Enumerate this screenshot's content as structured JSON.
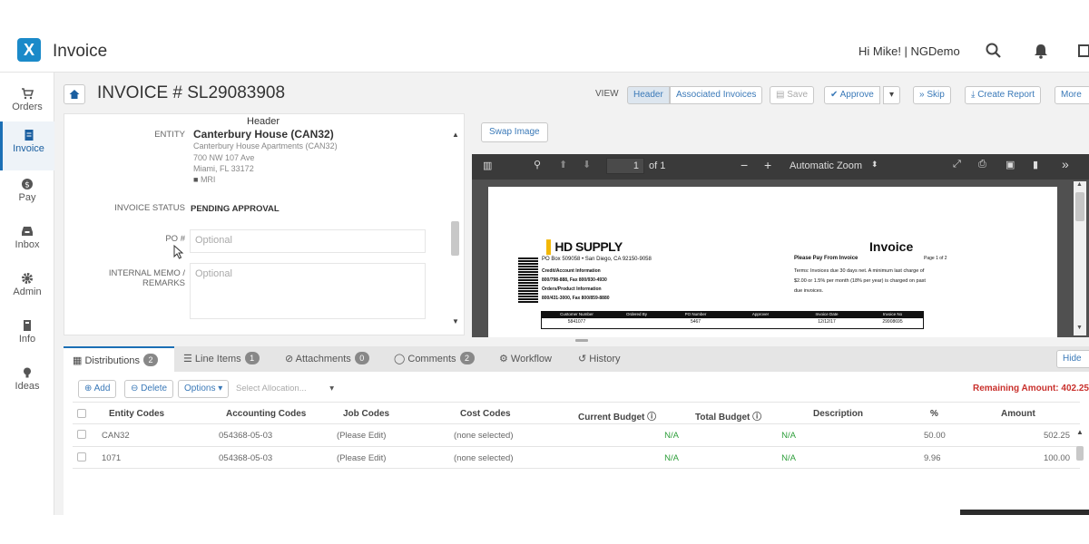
{
  "app": {
    "logo_letter": "X",
    "title": "Invoice",
    "greeting": "Hi Mike! | NGDemo"
  },
  "sidebar": {
    "items": [
      {
        "label": "Orders",
        "icon": "cart-icon"
      },
      {
        "label": "Invoice",
        "icon": "invoice-icon"
      },
      {
        "label": "Pay",
        "icon": "dollar-icon"
      },
      {
        "label": "Inbox",
        "icon": "inbox-icon"
      },
      {
        "label": "Admin",
        "icon": "gear-icon"
      },
      {
        "label": "Info",
        "icon": "info-icon"
      },
      {
        "label": "Ideas",
        "icon": "lightbulb-icon"
      }
    ]
  },
  "page": {
    "title": "INVOICE # SL29083908",
    "view_label": "VIEW",
    "buttons": {
      "header": "Header",
      "associated": "Associated Invoices",
      "save": "Save",
      "approve": "Approve",
      "skip": "Skip",
      "create_report": "Create Report",
      "more": "More"
    }
  },
  "form": {
    "section_title": "Header",
    "entity_label": "ENTITY",
    "entity_name": "Canterbury House (CAN32)",
    "entity_lines": [
      "Canterbury House Apartments (CAN32)",
      "700 NW 107 Ave",
      "Miami, FL 33172",
      "MRI"
    ],
    "status_label": "INVOICE STATUS",
    "status_value": "PENDING APPROVAL",
    "po_label": "PO #",
    "po_placeholder": "Optional",
    "memo_label": "INTERNAL MEMO / REMARKS",
    "memo_placeholder": "Optional"
  },
  "viewer": {
    "swap_label": "Swap Image",
    "page_current": "1",
    "page_total": "of 1",
    "zoom": "Automatic Zoom",
    "doc": {
      "brand": "HD SUPPLY",
      "address": "PO Box 509058 • San Diego, CA 92150-9058",
      "credit_line1": "Credit/Account Information",
      "credit_line2": "800/798-888, Fax 800/930-4930",
      "orders_line1": "Orders/Product Information",
      "orders_line2": "800/431-3000, Fax 800/859-8880",
      "title": "Invoice",
      "pay_from": "Please Pay From Invoice",
      "page_of": "Page 1 of 2",
      "terms1": "Terms: Invoices due 30 days net. A minimum last charge of",
      "terms2": "$2.00 or 1.5% per month (18% per year) is charged on past",
      "terms3": "due invoices.",
      "table_headers": [
        "Customer Number",
        "Ordered By",
        "PO Number",
        "Approver",
        "Invoice Date",
        "Invoice No"
      ],
      "table_values": [
        "5841077",
        "",
        "5467",
        "",
        "12/12/17",
        "29908695"
      ]
    }
  },
  "tabs": [
    {
      "label": "Distributions",
      "badge": "2"
    },
    {
      "label": "Line Items",
      "badge": "1"
    },
    {
      "label": "Attachments",
      "badge": "0"
    },
    {
      "label": "Comments",
      "badge": "2"
    },
    {
      "label": "Workflow",
      "badge": ""
    },
    {
      "label": "History",
      "badge": ""
    }
  ],
  "hide_label": "Hide",
  "grid": {
    "add": "Add",
    "delete": "Delete",
    "options": "Options",
    "allocation_placeholder": "Select Allocation...",
    "remaining": "Remaining Amount: 402.25",
    "headers": [
      "Entity Codes",
      "Accounting Codes",
      "Job Codes",
      "Cost Codes",
      "Current Budget",
      "Total Budget",
      "Description",
      "%",
      "Amount"
    ],
    "rows": [
      {
        "entity": "CAN32",
        "accounting": "054368-05-03",
        "job": "(Please Edit)",
        "cost": "(none selected)",
        "current": "N/A",
        "total": "N/A",
        "description": "",
        "pct": "50.00",
        "amount": "502.25"
      },
      {
        "entity": "1071",
        "accounting": "054368-05-03",
        "job": "(Please Edit)",
        "cost": "(none selected)",
        "current": "N/A",
        "total": "N/A",
        "description": "",
        "pct": "9.96",
        "amount": "100.00"
      }
    ]
  },
  "colors": {
    "accent": "#1b6fb5",
    "remaining": "#c9302c",
    "na_green": "#2d9e3a"
  }
}
